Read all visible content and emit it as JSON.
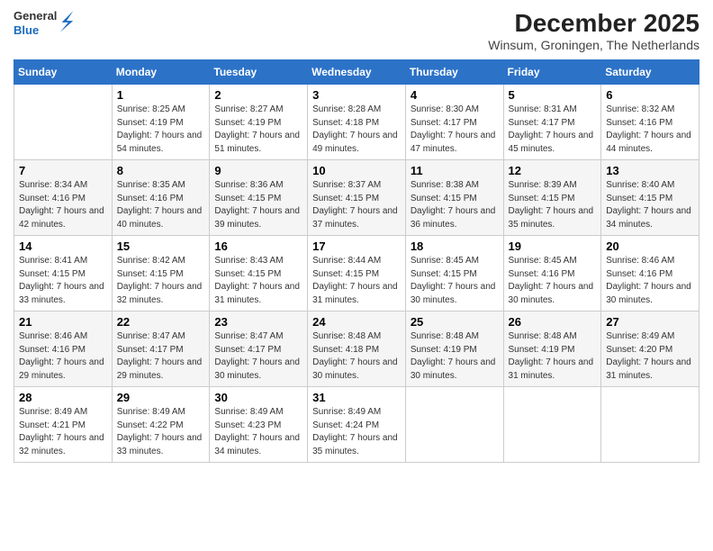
{
  "header": {
    "logo": {
      "general": "General",
      "blue": "Blue"
    },
    "title": "December 2025",
    "subtitle": "Winsum, Groningen, The Netherlands"
  },
  "days_of_week": [
    "Sunday",
    "Monday",
    "Tuesday",
    "Wednesday",
    "Thursday",
    "Friday",
    "Saturday"
  ],
  "weeks": [
    [
      {
        "day": "",
        "sunrise": "",
        "sunset": "",
        "daylight": ""
      },
      {
        "day": "1",
        "sunrise": "Sunrise: 8:25 AM",
        "sunset": "Sunset: 4:19 PM",
        "daylight": "Daylight: 7 hours and 54 minutes."
      },
      {
        "day": "2",
        "sunrise": "Sunrise: 8:27 AM",
        "sunset": "Sunset: 4:19 PM",
        "daylight": "Daylight: 7 hours and 51 minutes."
      },
      {
        "day": "3",
        "sunrise": "Sunrise: 8:28 AM",
        "sunset": "Sunset: 4:18 PM",
        "daylight": "Daylight: 7 hours and 49 minutes."
      },
      {
        "day": "4",
        "sunrise": "Sunrise: 8:30 AM",
        "sunset": "Sunset: 4:17 PM",
        "daylight": "Daylight: 7 hours and 47 minutes."
      },
      {
        "day": "5",
        "sunrise": "Sunrise: 8:31 AM",
        "sunset": "Sunset: 4:17 PM",
        "daylight": "Daylight: 7 hours and 45 minutes."
      },
      {
        "day": "6",
        "sunrise": "Sunrise: 8:32 AM",
        "sunset": "Sunset: 4:16 PM",
        "daylight": "Daylight: 7 hours and 44 minutes."
      }
    ],
    [
      {
        "day": "7",
        "sunrise": "Sunrise: 8:34 AM",
        "sunset": "Sunset: 4:16 PM",
        "daylight": "Daylight: 7 hours and 42 minutes."
      },
      {
        "day": "8",
        "sunrise": "Sunrise: 8:35 AM",
        "sunset": "Sunset: 4:16 PM",
        "daylight": "Daylight: 7 hours and 40 minutes."
      },
      {
        "day": "9",
        "sunrise": "Sunrise: 8:36 AM",
        "sunset": "Sunset: 4:15 PM",
        "daylight": "Daylight: 7 hours and 39 minutes."
      },
      {
        "day": "10",
        "sunrise": "Sunrise: 8:37 AM",
        "sunset": "Sunset: 4:15 PM",
        "daylight": "Daylight: 7 hours and 37 minutes."
      },
      {
        "day": "11",
        "sunrise": "Sunrise: 8:38 AM",
        "sunset": "Sunset: 4:15 PM",
        "daylight": "Daylight: 7 hours and 36 minutes."
      },
      {
        "day": "12",
        "sunrise": "Sunrise: 8:39 AM",
        "sunset": "Sunset: 4:15 PM",
        "daylight": "Daylight: 7 hours and 35 minutes."
      },
      {
        "day": "13",
        "sunrise": "Sunrise: 8:40 AM",
        "sunset": "Sunset: 4:15 PM",
        "daylight": "Daylight: 7 hours and 34 minutes."
      }
    ],
    [
      {
        "day": "14",
        "sunrise": "Sunrise: 8:41 AM",
        "sunset": "Sunset: 4:15 PM",
        "daylight": "Daylight: 7 hours and 33 minutes."
      },
      {
        "day": "15",
        "sunrise": "Sunrise: 8:42 AM",
        "sunset": "Sunset: 4:15 PM",
        "daylight": "Daylight: 7 hours and 32 minutes."
      },
      {
        "day": "16",
        "sunrise": "Sunrise: 8:43 AM",
        "sunset": "Sunset: 4:15 PM",
        "daylight": "Daylight: 7 hours and 31 minutes."
      },
      {
        "day": "17",
        "sunrise": "Sunrise: 8:44 AM",
        "sunset": "Sunset: 4:15 PM",
        "daylight": "Daylight: 7 hours and 31 minutes."
      },
      {
        "day": "18",
        "sunrise": "Sunrise: 8:45 AM",
        "sunset": "Sunset: 4:15 PM",
        "daylight": "Daylight: 7 hours and 30 minutes."
      },
      {
        "day": "19",
        "sunrise": "Sunrise: 8:45 AM",
        "sunset": "Sunset: 4:16 PM",
        "daylight": "Daylight: 7 hours and 30 minutes."
      },
      {
        "day": "20",
        "sunrise": "Sunrise: 8:46 AM",
        "sunset": "Sunset: 4:16 PM",
        "daylight": "Daylight: 7 hours and 30 minutes."
      }
    ],
    [
      {
        "day": "21",
        "sunrise": "Sunrise: 8:46 AM",
        "sunset": "Sunset: 4:16 PM",
        "daylight": "Daylight: 7 hours and 29 minutes."
      },
      {
        "day": "22",
        "sunrise": "Sunrise: 8:47 AM",
        "sunset": "Sunset: 4:17 PM",
        "daylight": "Daylight: 7 hours and 29 minutes."
      },
      {
        "day": "23",
        "sunrise": "Sunrise: 8:47 AM",
        "sunset": "Sunset: 4:17 PM",
        "daylight": "Daylight: 7 hours and 30 minutes."
      },
      {
        "day": "24",
        "sunrise": "Sunrise: 8:48 AM",
        "sunset": "Sunset: 4:18 PM",
        "daylight": "Daylight: 7 hours and 30 minutes."
      },
      {
        "day": "25",
        "sunrise": "Sunrise: 8:48 AM",
        "sunset": "Sunset: 4:19 PM",
        "daylight": "Daylight: 7 hours and 30 minutes."
      },
      {
        "day": "26",
        "sunrise": "Sunrise: 8:48 AM",
        "sunset": "Sunset: 4:19 PM",
        "daylight": "Daylight: 7 hours and 31 minutes."
      },
      {
        "day": "27",
        "sunrise": "Sunrise: 8:49 AM",
        "sunset": "Sunset: 4:20 PM",
        "daylight": "Daylight: 7 hours and 31 minutes."
      }
    ],
    [
      {
        "day": "28",
        "sunrise": "Sunrise: 8:49 AM",
        "sunset": "Sunset: 4:21 PM",
        "daylight": "Daylight: 7 hours and 32 minutes."
      },
      {
        "day": "29",
        "sunrise": "Sunrise: 8:49 AM",
        "sunset": "Sunset: 4:22 PM",
        "daylight": "Daylight: 7 hours and 33 minutes."
      },
      {
        "day": "30",
        "sunrise": "Sunrise: 8:49 AM",
        "sunset": "Sunset: 4:23 PM",
        "daylight": "Daylight: 7 hours and 34 minutes."
      },
      {
        "day": "31",
        "sunrise": "Sunrise: 8:49 AM",
        "sunset": "Sunset: 4:24 PM",
        "daylight": "Daylight: 7 hours and 35 minutes."
      },
      {
        "day": "",
        "sunrise": "",
        "sunset": "",
        "daylight": ""
      },
      {
        "day": "",
        "sunrise": "",
        "sunset": "",
        "daylight": ""
      },
      {
        "day": "",
        "sunrise": "",
        "sunset": "",
        "daylight": ""
      }
    ]
  ]
}
